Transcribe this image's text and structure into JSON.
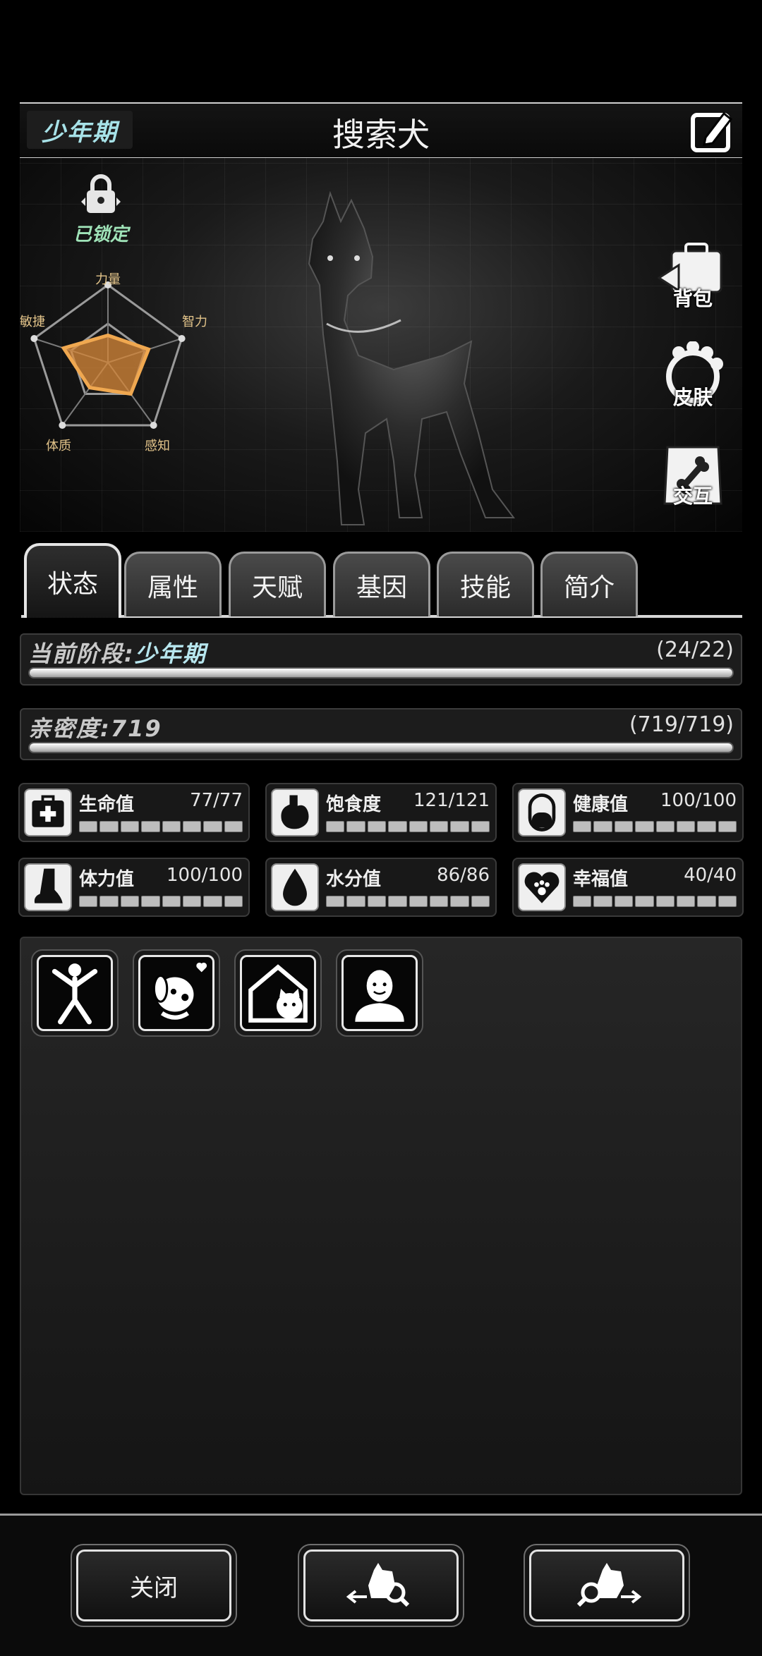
{
  "header": {
    "stage_tag": "少年期",
    "pet_name": "搜索犬"
  },
  "lock": {
    "label": "已锁定"
  },
  "radar": {
    "labels": [
      "力量",
      "智力",
      "感知",
      "体质",
      "敏捷"
    ],
    "values": [
      0.35,
      0.55,
      0.5,
      0.4,
      0.6
    ]
  },
  "side_buttons": {
    "bag": "背包",
    "skin": "皮肤",
    "interact": "交互"
  },
  "tabs": [
    "状态",
    "属性",
    "天赋",
    "基因",
    "技能",
    "简介"
  ],
  "stage_bar": {
    "label": "当前阶段:",
    "value": "少年期",
    "count": "(24/22)",
    "progress": 1.0
  },
  "intimacy_bar": {
    "label": "亲密度:",
    "value": "719",
    "count": "(719/719)",
    "progress": 1.0
  },
  "stats": [
    {
      "name": "生命值",
      "value": "77/77",
      "icon": "medkit-icon"
    },
    {
      "name": "饱食度",
      "value": "121/121",
      "icon": "stomach-icon"
    },
    {
      "name": "健康值",
      "value": "100/100",
      "icon": "pill-icon"
    },
    {
      "name": "体力值",
      "value": "100/100",
      "icon": "paw-leg-icon"
    },
    {
      "name": "水分值",
      "value": "86/86",
      "icon": "water-drop-icon"
    },
    {
      "name": "幸福值",
      "value": "40/40",
      "icon": "heart-paw-icon"
    }
  ],
  "footer": {
    "close_label": "关闭"
  },
  "colors": {
    "accent_cyan": "#b7e6ee",
    "radar_fill": "#d98a3a",
    "lock_green": "#9fe3b8"
  }
}
